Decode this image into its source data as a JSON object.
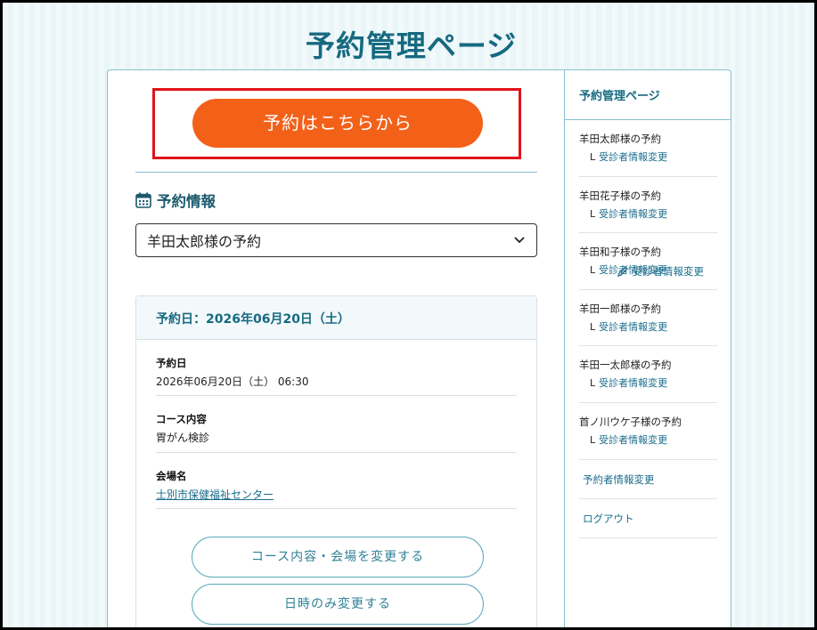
{
  "page": {
    "title": "予約管理ページ"
  },
  "reserve_button": {
    "label": "予約はこちらから"
  },
  "section": {
    "title": "予約情報",
    "icon": "calendar-icon"
  },
  "select": {
    "value": "羊田太郎様の予約"
  },
  "edit_link": {
    "label": "受診者情報変更",
    "icon": "pencil-icon"
  },
  "detail": {
    "header": "予約日：2026年06月20日（土）",
    "rows": [
      {
        "label": "予約日",
        "value": "2026年06月20日（土） 06:30"
      },
      {
        "label": "コース内容",
        "value": "胃がん検診"
      },
      {
        "label": "会場名",
        "value": "士別市保健福祉センター"
      }
    ],
    "change_course_button": "コース内容・会場を変更する",
    "change_date_button": "日時のみ変更する"
  },
  "sidebar": {
    "title": "予約管理ページ",
    "items": [
      {
        "name": "羊田太郎様の予約",
        "sub_prefix": "L",
        "sub": "受診者情報変更"
      },
      {
        "name": "羊田花子様の予約",
        "sub_prefix": "L",
        "sub": "受診者情報変更"
      },
      {
        "name": "羊田和子様の予約",
        "sub_prefix": "L",
        "sub": "受診者情報変更"
      },
      {
        "name": "羊田一郎様の予約",
        "sub_prefix": "L",
        "sub": "受診者情報変更"
      },
      {
        "name": "羊田一太郎様の予約",
        "sub_prefix": "L",
        "sub": "受診者情報変更"
      },
      {
        "name": "首ノ川ウケ子様の予約",
        "sub_prefix": "L",
        "sub": "受診者情報変更"
      }
    ],
    "links": [
      "予約者情報変更",
      "ログアウト"
    ]
  },
  "colors": {
    "accent": "#166a80",
    "primary_button": "#f36119",
    "highlight_border": "#e0121a",
    "link": "#1a6d8d"
  }
}
